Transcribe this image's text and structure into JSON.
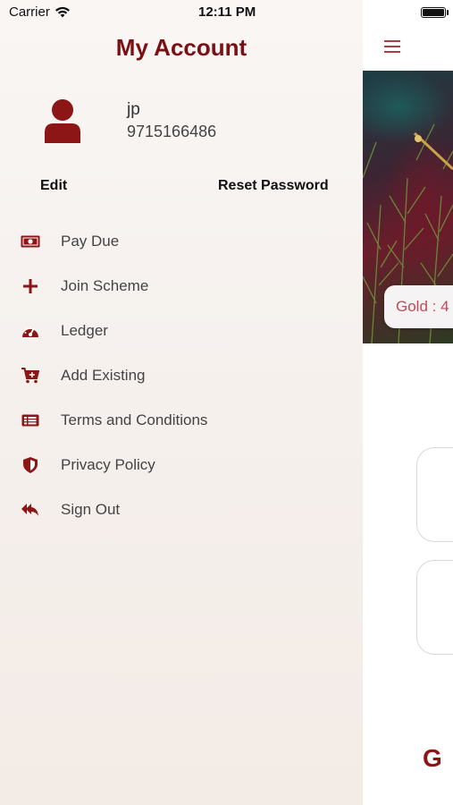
{
  "status_bar": {
    "carrier": "Carrier",
    "time": "12:11 PM"
  },
  "drawer": {
    "title": "My Account",
    "user": {
      "name": "jp",
      "phone": "9715166486"
    },
    "actions": {
      "edit": "Edit",
      "reset_password": "Reset Password"
    },
    "menu": [
      {
        "label": "Pay Due",
        "icon": "money-icon"
      },
      {
        "label": "Join Scheme",
        "icon": "plus-icon"
      },
      {
        "label": "Ledger",
        "icon": "speedometer-icon"
      },
      {
        "label": "Add Existing",
        "icon": "cart-plus-icon"
      },
      {
        "label": "Terms and Conditions",
        "icon": "document-list-icon"
      },
      {
        "label": "Privacy Policy",
        "icon": "shield-icon"
      },
      {
        "label": "Sign Out",
        "icon": "reply-all-icon"
      }
    ]
  },
  "background_screen": {
    "gold_label": "Gold :  4",
    "logo_letter": "G"
  },
  "colors": {
    "accent": "#7a0f14",
    "icon": "#8c1515",
    "menu_text": "#444444"
  }
}
